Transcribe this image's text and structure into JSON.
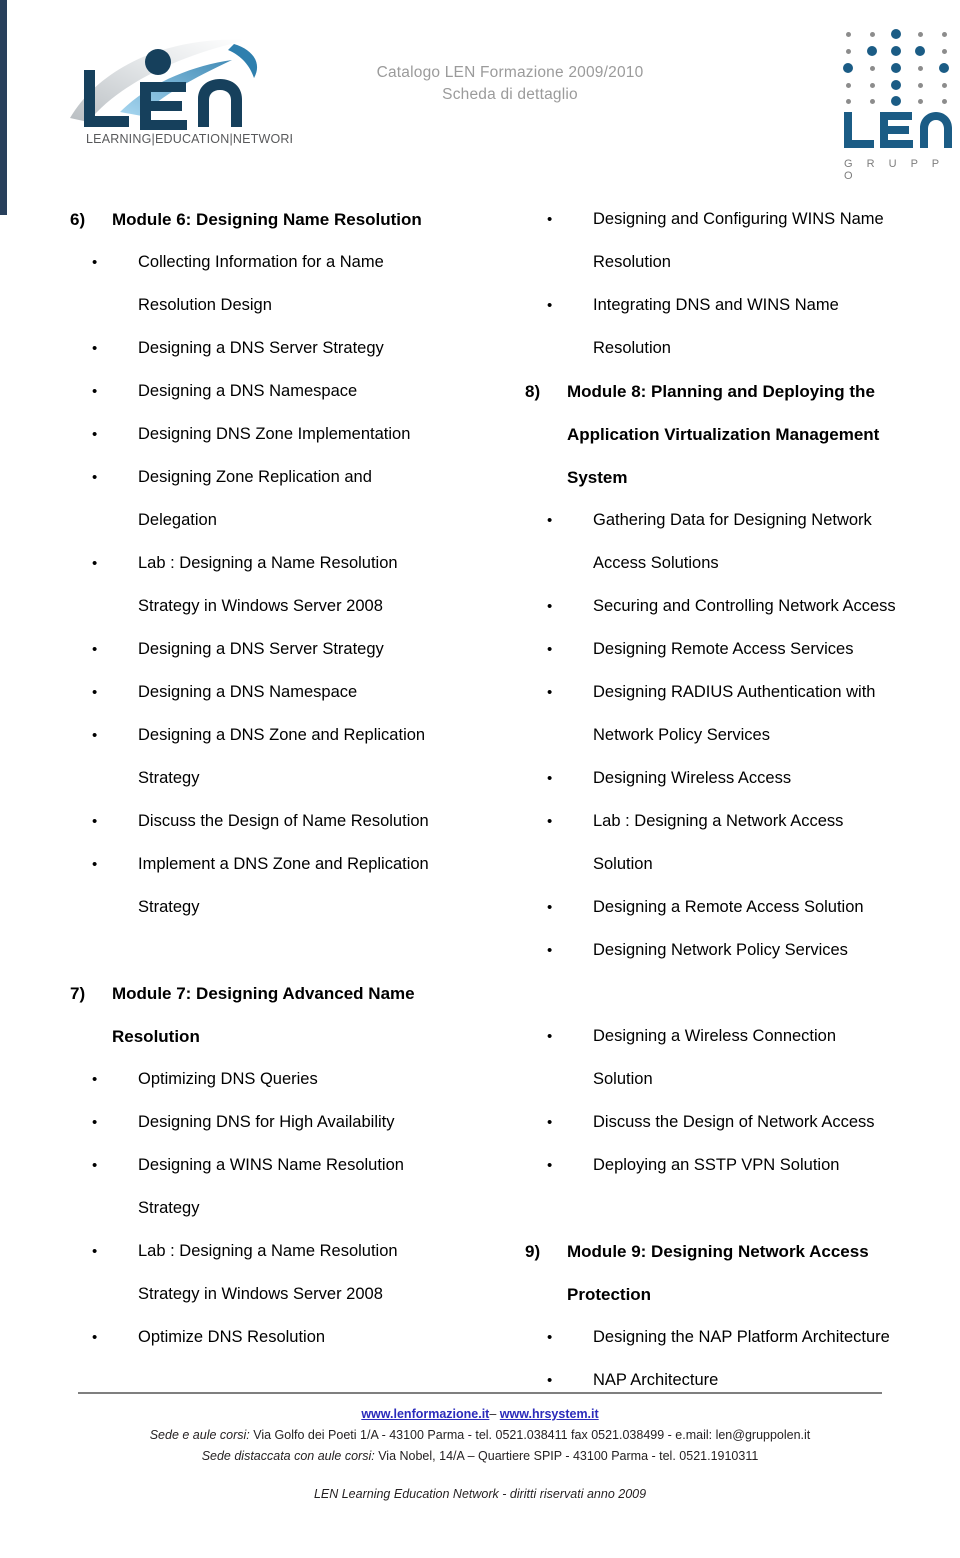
{
  "header": {
    "catalog_title_line1": "Catalogo LEN Formazione 2009/2010",
    "catalog_title_line2": "Scheda di dettaglio",
    "logo_wordmark": "LEN",
    "logo_tagline": "LEARNING|EDUCATION|NETWORK",
    "gruppo_wordmark": "LEN",
    "gruppo_sub": "G R U P P O",
    "accent_color": "#28405c",
    "title_color": "#9b9b9b",
    "dot_color": "#1b5c85"
  },
  "left_column": [
    {
      "type": "module",
      "num": "6)",
      "title": "Module 6: Designing Name Resolution"
    },
    {
      "type": "bullet",
      "text": "Collecting Information for a Name"
    },
    {
      "type": "cont",
      "text": "Resolution Design"
    },
    {
      "type": "bullet",
      "text": "Designing a DNS Server Strategy"
    },
    {
      "type": "bullet",
      "text": "Designing a DNS Namespace"
    },
    {
      "type": "bullet",
      "text": "Designing DNS Zone Implementation"
    },
    {
      "type": "bullet",
      "text": "Designing Zone Replication and"
    },
    {
      "type": "cont",
      "text": "Delegation"
    },
    {
      "type": "bullet",
      "text": "Lab : Designing a Name Resolution"
    },
    {
      "type": "cont",
      "text": "Strategy in Windows Server 2008"
    },
    {
      "type": "bullet",
      "text": "Designing a DNS Server Strategy"
    },
    {
      "type": "bullet",
      "text": "Designing a DNS Namespace"
    },
    {
      "type": "bullet",
      "text": "Designing a DNS Zone and Replication"
    },
    {
      "type": "cont",
      "text": "Strategy"
    },
    {
      "type": "bullet",
      "text": "Discuss the Design of Name Resolution"
    },
    {
      "type": "bullet",
      "text": "Implement a DNS Zone and Replication"
    },
    {
      "type": "cont",
      "text": "Strategy"
    },
    {
      "type": "spacer"
    },
    {
      "type": "module",
      "num": "7)",
      "title": "Module 7: Designing Advanced Name"
    },
    {
      "type": "cont-bold",
      "text": "Resolution"
    },
    {
      "type": "bullet",
      "text": "Optimizing DNS Queries"
    },
    {
      "type": "bullet",
      "text": "Designing DNS for High Availability"
    },
    {
      "type": "bullet",
      "text": "Designing a WINS Name Resolution"
    },
    {
      "type": "cont",
      "text": "Strategy"
    },
    {
      "type": "bullet",
      "text": "Lab : Designing a Name Resolution"
    },
    {
      "type": "cont",
      "text": "Strategy in Windows Server 2008"
    },
    {
      "type": "bullet",
      "text": "Optimize DNS Resolution"
    }
  ],
  "right_column": [
    {
      "type": "bullet",
      "text": "Designing and Configuring WINS Name"
    },
    {
      "type": "cont",
      "text": "Resolution"
    },
    {
      "type": "bullet",
      "text": "Integrating DNS and WINS Name"
    },
    {
      "type": "cont",
      "text": "Resolution"
    },
    {
      "type": "module",
      "num": "8)",
      "title": "Module 8: Planning and Deploying the"
    },
    {
      "type": "cont-bold",
      "text": "Application Virtualization Management"
    },
    {
      "type": "cont-bold",
      "text": "System"
    },
    {
      "type": "bullet",
      "text": "Gathering Data for Designing Network"
    },
    {
      "type": "cont",
      "text": "Access Solutions"
    },
    {
      "type": "bullet",
      "text": "Securing and Controlling Network Access"
    },
    {
      "type": "bullet",
      "text": "Designing Remote Access Services"
    },
    {
      "type": "bullet",
      "text": "Designing RADIUS Authentication with"
    },
    {
      "type": "cont",
      "text": "Network Policy Services"
    },
    {
      "type": "bullet",
      "text": "Designing Wireless Access"
    },
    {
      "type": "bullet",
      "text": "Lab : Designing a Network Access"
    },
    {
      "type": "cont",
      "text": "Solution"
    },
    {
      "type": "bullet",
      "text": "Designing a Remote Access Solution"
    },
    {
      "type": "bullet",
      "text": "Designing Network Policy Services"
    },
    {
      "type": "spacer"
    },
    {
      "type": "bullet",
      "text": "Designing a Wireless Connection"
    },
    {
      "type": "cont",
      "text": "Solution"
    },
    {
      "type": "bullet",
      "text": "Discuss the Design of Network Access"
    },
    {
      "type": "bullet",
      "text": "Deploying an SSTP VPN Solution"
    },
    {
      "type": "spacer"
    },
    {
      "type": "module",
      "num": "9)",
      "title": "Module 9: Designing Network Access"
    },
    {
      "type": "cont-bold",
      "text": "Protection"
    },
    {
      "type": "bullet",
      "text": "Designing the NAP Platform Architecture"
    },
    {
      "type": "bullet",
      "text": "NAP Architecture"
    }
  ],
  "footer": {
    "link1": "www.lenformazione.it",
    "link_separator": "–",
    "link2": "www.hrsystem.it",
    "address_label_1": "Sede e aule corsi:",
    "address_text_1": " Via Golfo dei Poeti 1/A - 43100 Parma -  tel. 0521.038411 fax 0521.038499 - e.mail: len@gruppolen.it",
    "address_label_2": "Sede distaccata con aule corsi:",
    "address_text_2": " Via  Nobel, 14/A – Quartiere SPIP - 43100 Parma - tel. 0521.1910311",
    "rights": "LEN Learning Education Network  - diritti riservati anno 2009",
    "link_color": "#2b2bbb"
  }
}
